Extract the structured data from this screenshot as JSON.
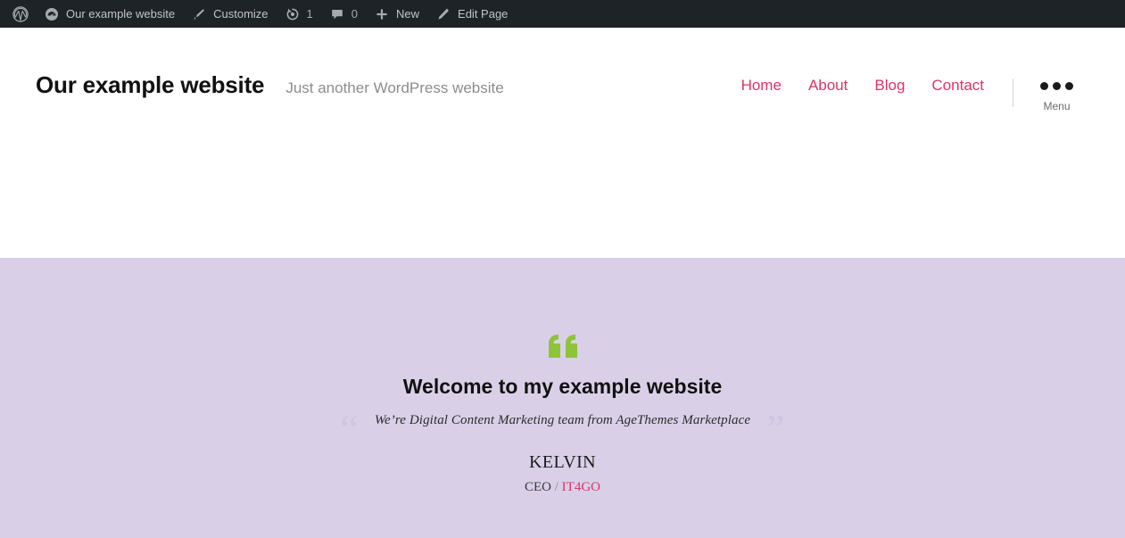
{
  "admin_bar": {
    "items": [
      {
        "icon": "wordpress-logo-icon",
        "label": "",
        "name": "wp-logo"
      },
      {
        "icon": "dashboard-icon",
        "label": "Our example website",
        "name": "site-name"
      },
      {
        "icon": "paintbrush-icon",
        "label": "Customize",
        "name": "customize"
      },
      {
        "icon": "updates-icon",
        "label": "1",
        "name": "updates"
      },
      {
        "icon": "comment-bubble-icon",
        "label": "0",
        "name": "comments"
      },
      {
        "icon": "plus-icon",
        "label": "New",
        "name": "new-content"
      },
      {
        "icon": "pencil-icon",
        "label": "Edit Page",
        "name": "edit-page"
      }
    ],
    "background": "#1d2327",
    "text_color": "#c3c4c7"
  },
  "header": {
    "site_title": "Our example website",
    "site_description": "Just another WordPress website",
    "nav": [
      {
        "label": "Home"
      },
      {
        "label": "About"
      },
      {
        "label": "Blog"
      },
      {
        "label": "Contact"
      }
    ],
    "menu_toggle_label": "Menu",
    "accent_color": "#dd3366"
  },
  "testimonial": {
    "quote_mark": "“",
    "heading": "Welcome to my example website",
    "quote_open": "“",
    "quote_close": "”",
    "quote_text": "We’re Digital Content Marketing team from AgeThemes Marketplace",
    "author": "KELVIN",
    "role": "CEO",
    "separator": "/",
    "company": "IT4GO",
    "background": "#d9d0e8",
    "badge_color": "#8fc33a"
  }
}
